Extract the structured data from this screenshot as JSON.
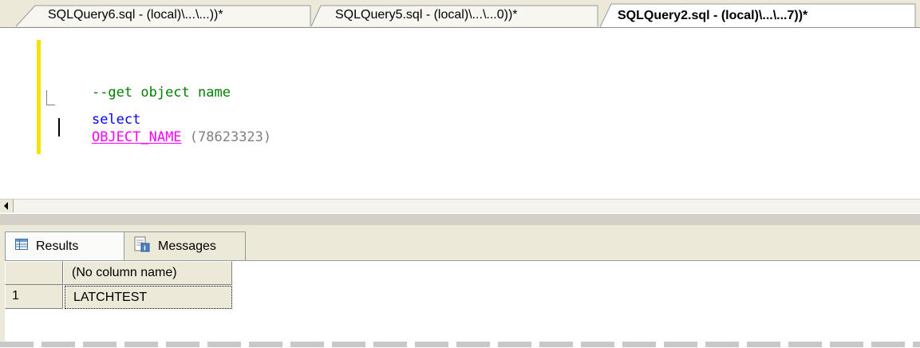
{
  "tabs": [
    {
      "label": "SQLQuery6.sql - (local)\\...\\...))*",
      "active": false
    },
    {
      "label": "SQLQuery5.sql - (local)\\...\\...0))*",
      "active": false
    },
    {
      "label": "SQLQuery2.sql - (local)\\...\\...7))*",
      "active": true
    }
  ],
  "editor": {
    "comment": "--get object name",
    "keyword": "select",
    "function": "OBJECT_NAME",
    "argument": " (78623323)"
  },
  "results_tabs": {
    "results_label": "Results",
    "messages_label": "Messages"
  },
  "grid": {
    "column_header": "(No column name)",
    "rows": [
      {
        "row_number": "1",
        "value": "LATCHTEST"
      }
    ]
  },
  "colors": {
    "keyword": "#0000ff",
    "function": "#ff00ff",
    "comment": "#008000",
    "literal": "#808080",
    "change_bar": "#f3e300"
  },
  "icons": [
    "scroll-left-icon",
    "results-grid-icon",
    "messages-icon"
  ]
}
